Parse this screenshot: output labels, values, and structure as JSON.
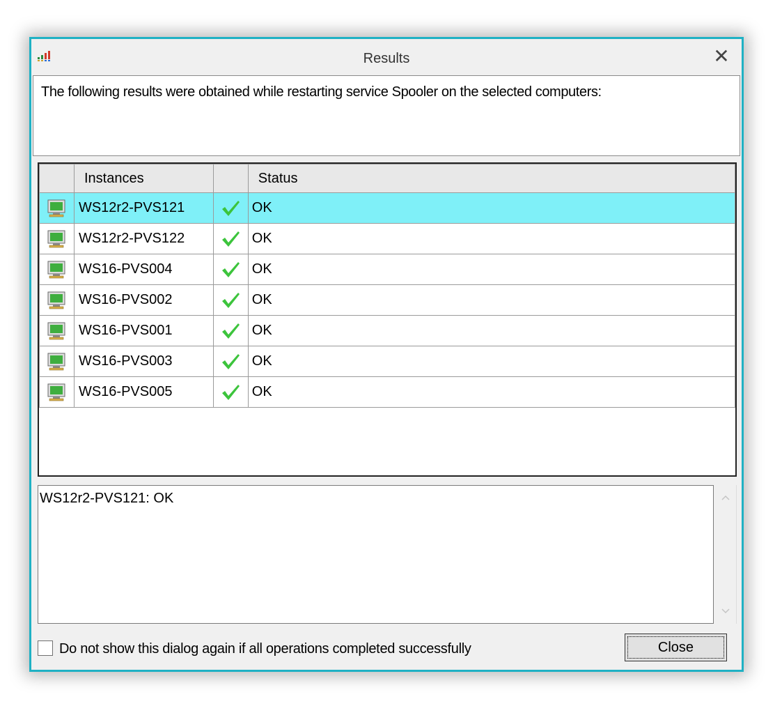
{
  "window": {
    "title": "Results",
    "app_icon": "bar-chart-app-icon",
    "close_icon": "close-icon",
    "close_symbol": "✕"
  },
  "header": {
    "text": "The following results were obtained while restarting service Spooler on the selected computers:"
  },
  "table": {
    "columns": [
      "",
      "Instances",
      "",
      "Status"
    ],
    "rows": [
      {
        "instance": "WS12r2-PVS121",
        "status": "OK",
        "icon": "computer-icon",
        "status_icon": "checkmark-icon",
        "selected": true
      },
      {
        "instance": "WS12r2-PVS122",
        "status": "OK",
        "icon": "computer-icon",
        "status_icon": "checkmark-icon",
        "selected": false
      },
      {
        "instance": "WS16-PVS004",
        "status": "OK",
        "icon": "computer-icon",
        "status_icon": "checkmark-icon",
        "selected": false
      },
      {
        "instance": "WS16-PVS002",
        "status": "OK",
        "icon": "computer-icon",
        "status_icon": "checkmark-icon",
        "selected": false
      },
      {
        "instance": "WS16-PVS001",
        "status": "OK",
        "icon": "computer-icon",
        "status_icon": "checkmark-icon",
        "selected": false
      },
      {
        "instance": "WS16-PVS003",
        "status": "OK",
        "icon": "computer-icon",
        "status_icon": "checkmark-icon",
        "selected": false
      },
      {
        "instance": "WS16-PVS005",
        "status": "OK",
        "icon": "computer-icon",
        "status_icon": "checkmark-icon",
        "selected": false
      }
    ]
  },
  "detail": {
    "text": "WS12r2-PVS121: OK"
  },
  "footer": {
    "checkbox_label": "Do not show this dialog again if all operations completed successfully",
    "checkbox_checked": false,
    "close_button_label": "Close"
  },
  "colors": {
    "window_border": "#1fb1c4",
    "selected_row": "#7ff0f8",
    "check_green": "#3cc43c"
  }
}
